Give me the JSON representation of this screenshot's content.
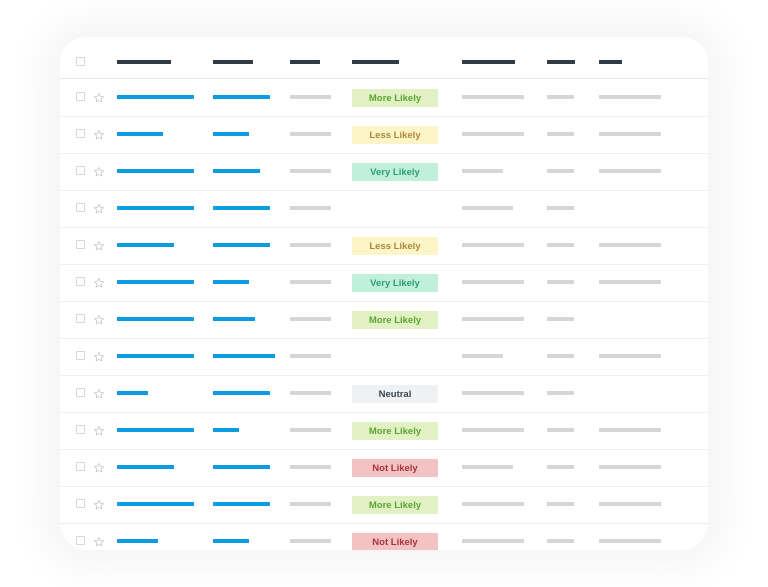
{
  "header": {
    "select_all_checkbox": false,
    "columns": [
      {
        "key": "col1",
        "placeholder_length": 0.54
      },
      {
        "key": "col2",
        "placeholder_length": 0.4
      },
      {
        "key": "col3",
        "placeholder_length": 0.3
      },
      {
        "key": "likelihood",
        "placeholder_length": 0.48
      },
      {
        "key": "col5",
        "placeholder_length": 0.54
      },
      {
        "key": "col6",
        "placeholder_length": 0.3
      },
      {
        "key": "col7",
        "placeholder_length": 0.24
      }
    ]
  },
  "status_styles": {
    "More Likely": {
      "bg": "#e2f1c4",
      "fg": "#5aa532"
    },
    "Less Likely": {
      "bg": "#fdf5c7",
      "fg": "#a98a36"
    },
    "Very Likely": {
      "bg": "#c0efdc",
      "fg": "#2b9e79"
    },
    "Neutral": {
      "bg": "#f0f1f2",
      "fg": "#3a4550"
    },
    "Not Likely": {
      "bg": "#f3c3c4",
      "fg": "#a8343a"
    }
  },
  "colors": {
    "header_bar": "#2f3b45",
    "link_bar": "#0a9be0",
    "placeholder_bar": "#d4d6d8"
  },
  "rows": [
    {
      "checked": false,
      "starred": false,
      "c1": 1.0,
      "c2": 1.0,
      "c3": true,
      "status": "More Likely",
      "c5": 1.0,
      "c6": true,
      "c7": true
    },
    {
      "checked": false,
      "starred": false,
      "c1": 0.6,
      "c2": 0.64,
      "c3": true,
      "status": "Less Likely",
      "c5": 1.0,
      "c6": true,
      "c7": true
    },
    {
      "checked": false,
      "starred": false,
      "c1": 1.0,
      "c2": 0.82,
      "c3": true,
      "status": "Very Likely",
      "c5": 0.66,
      "c6": true,
      "c7": true
    },
    {
      "checked": false,
      "starred": false,
      "c1": 1.0,
      "c2": 1.0,
      "c3": true,
      "status": "",
      "c5": 0.83,
      "c6": true,
      "c7": false
    },
    {
      "checked": false,
      "starred": false,
      "c1": 0.74,
      "c2": 1.0,
      "c3": true,
      "status": "Less Likely",
      "c5": 1.0,
      "c6": true,
      "c7": true
    },
    {
      "checked": false,
      "starred": false,
      "c1": 1.0,
      "c2": 0.64,
      "c3": true,
      "status": "Very Likely",
      "c5": 1.0,
      "c6": true,
      "c7": true
    },
    {
      "checked": false,
      "starred": false,
      "c1": 1.0,
      "c2": 0.73,
      "c3": true,
      "status": "More Likely",
      "c5": 1.0,
      "c6": true,
      "c7": false
    },
    {
      "checked": false,
      "starred": false,
      "c1": 1.0,
      "c2": 1.09,
      "c3": true,
      "status": "",
      "c5": 0.66,
      "c6": true,
      "c7": true
    },
    {
      "checked": false,
      "starred": false,
      "c1": 0.4,
      "c2": 1.0,
      "c3": true,
      "status": "Neutral",
      "c5": 1.0,
      "c6": true,
      "c7": false
    },
    {
      "checked": false,
      "starred": false,
      "c1": 1.0,
      "c2": 0.46,
      "c3": true,
      "status": "More Likely",
      "c5": 1.0,
      "c6": true,
      "c7": true
    },
    {
      "checked": false,
      "starred": false,
      "c1": 0.74,
      "c2": 1.0,
      "c3": true,
      "status": "Not Likely",
      "c5": 0.83,
      "c6": true,
      "c7": true
    },
    {
      "checked": false,
      "starred": false,
      "c1": 1.0,
      "c2": 1.0,
      "c3": true,
      "status": "More Likely",
      "c5": 1.0,
      "c6": true,
      "c7": true
    },
    {
      "checked": false,
      "starred": false,
      "c1": 0.53,
      "c2": 0.64,
      "c3": true,
      "status": "Not Likely",
      "c5": 1.0,
      "c6": true,
      "c7": true
    }
  ]
}
